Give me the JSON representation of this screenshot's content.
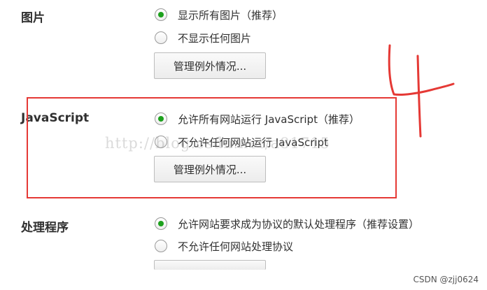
{
  "sections": {
    "images": {
      "title": "图片",
      "options": [
        "显示所有图片（推荐）",
        "不显示任何图片"
      ],
      "selected": 0,
      "button": "管理例外情况..."
    },
    "javascript": {
      "title": "JavaScript",
      "options": [
        "允许所有网站运行 JavaScript（推荐）",
        "不允许任何网站运行 JavaScript"
      ],
      "selected": 0,
      "button": "管理例外情况..."
    },
    "handlers": {
      "title": "处理程序",
      "options": [
        "允许网站要求成为协议的默认处理程序（推荐设置）",
        "不允许任何网站处理协议"
      ],
      "selected": 0
    }
  },
  "annotation": {
    "handwritten_mark": "4",
    "highlight_color": "#e53935"
  },
  "watermark": "http://blog.csdn.net/a81715",
  "footer": {
    "credit": "CSDN @zjj0624"
  },
  "colors": {
    "radio_selected": "#1da11d",
    "highlight_box": "#e53935"
  }
}
